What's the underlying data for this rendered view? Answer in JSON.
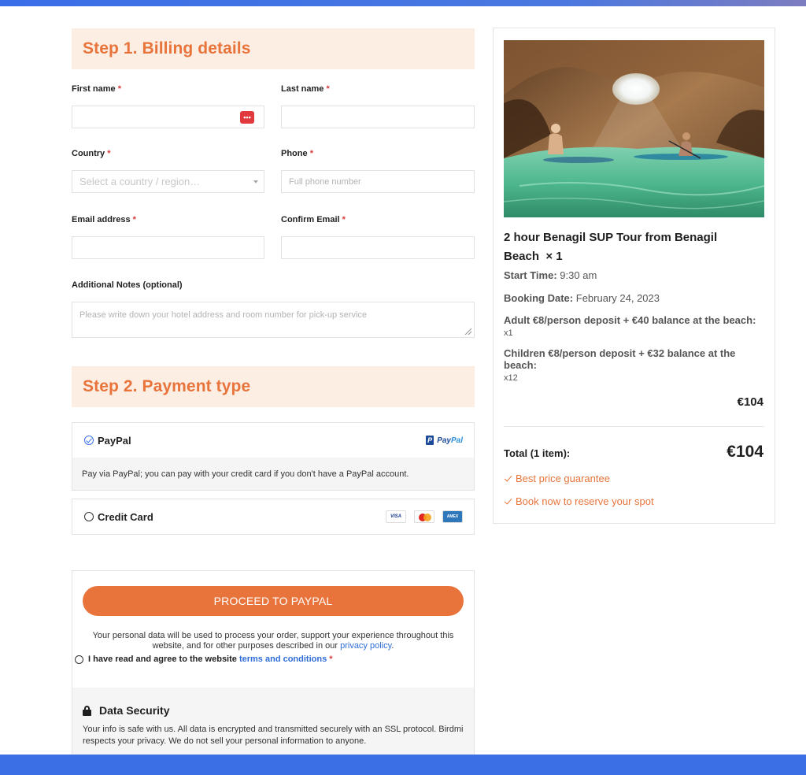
{
  "billing": {
    "heading": "Step 1. Billing details",
    "first_name_label": "First name",
    "last_name_label": "Last name",
    "country_label": "Country",
    "country_placeholder": "Select a country / region…",
    "phone_label": "Phone",
    "phone_placeholder": "Full phone number",
    "email_label": "Email address",
    "confirm_email_label": "Confirm Email",
    "notes_label": "Additional Notes (optional)",
    "notes_placeholder": "Please write down your hotel address and room number for pick-up service",
    "required_mark": "*"
  },
  "payment": {
    "heading": "Step 2. Payment type",
    "paypal_label": "PayPal",
    "paypal_logo_pay": "Pay",
    "paypal_logo_pal": "Pal",
    "paypal_description": "Pay via PayPal; you can pay with your credit card if you don't have a PayPal account.",
    "credit_card_label": "Credit Card",
    "card_visa": "VISA",
    "card_amex": "AMEX"
  },
  "checkout": {
    "proceed_button": "PROCEED TO PAYPAL",
    "privacy_text": "Your personal data will be used to process your order, support your experience throughout this website, and for other purposes described in our",
    "privacy_link": "privacy policy",
    "privacy_end": ".",
    "agree_text": "I have read and agree to the website",
    "terms_link": "terms and conditions",
    "required_mark": "*",
    "security_title": "Data Security",
    "security_text": "Your info is safe with us. All data is encrypted and transmitted securely with an SSL protocol. Birdmi respects your privacy. We do not sell your personal information to anyone."
  },
  "summary": {
    "tour_title": "2 hour Benagil SUP Tour from Benagil Beach",
    "quantity": "× 1",
    "start_time_label": "Start Time:",
    "start_time": "9:30 am",
    "booking_date_label": "Booking Date:",
    "booking_date": "February 24, 2023",
    "adult_line": "Adult €8/person deposit + €40 balance at the beach:",
    "adult_qty": "x1",
    "children_line": "Children €8/person deposit + €32 balance at the beach:",
    "children_qty": "x12",
    "subtotal": "€104",
    "total_label": "Total (1 item):",
    "total_value": "€104",
    "perk_1": "Best price guarantee",
    "perk_2": "Book now to reserve your spot"
  },
  "colors": {
    "accent": "#e8743b",
    "link": "#2e6dd8",
    "band": "#3b6fe6"
  }
}
